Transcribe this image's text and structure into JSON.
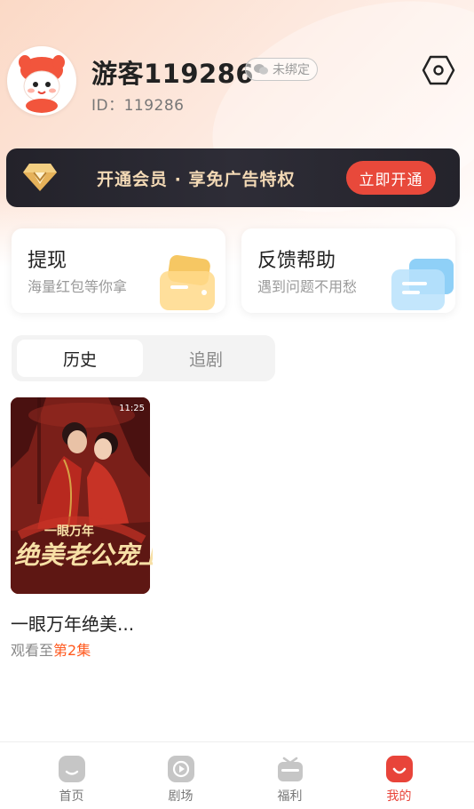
{
  "profile": {
    "username": "游客119286",
    "bind_status": "未绑定",
    "user_id": "ID：119286"
  },
  "vip": {
    "promo_text": "开通会员 · 享免广告特权",
    "cta_label": "立即开通"
  },
  "cards": [
    {
      "title": "提现",
      "subtitle": "海量红包等你拿",
      "icon": "wallet-icon"
    },
    {
      "title": "反馈帮助",
      "subtitle": "遇到问题不用愁",
      "icon": "feedback-icon"
    }
  ],
  "tabs": [
    {
      "label": "历史",
      "active": true
    },
    {
      "label": "追剧",
      "active": false
    }
  ],
  "history": [
    {
      "title": "一眼万年绝美...",
      "duration": "11:25",
      "progress_prefix": "观看至",
      "progress_episode": "第2集"
    }
  ],
  "bottom_nav": [
    {
      "label": "首页",
      "icon": "home-icon",
      "active": false
    },
    {
      "label": "剧场",
      "icon": "theater-icon",
      "active": false
    },
    {
      "label": "福利",
      "icon": "gift-icon",
      "active": false
    },
    {
      "label": "我的",
      "icon": "profile-icon",
      "active": true
    }
  ],
  "colors": {
    "accent": "#e8493b",
    "episode_highlight": "#ff5a1f",
    "vip_gold": "#f3d9b5",
    "vip_bg": "#2a2930"
  }
}
